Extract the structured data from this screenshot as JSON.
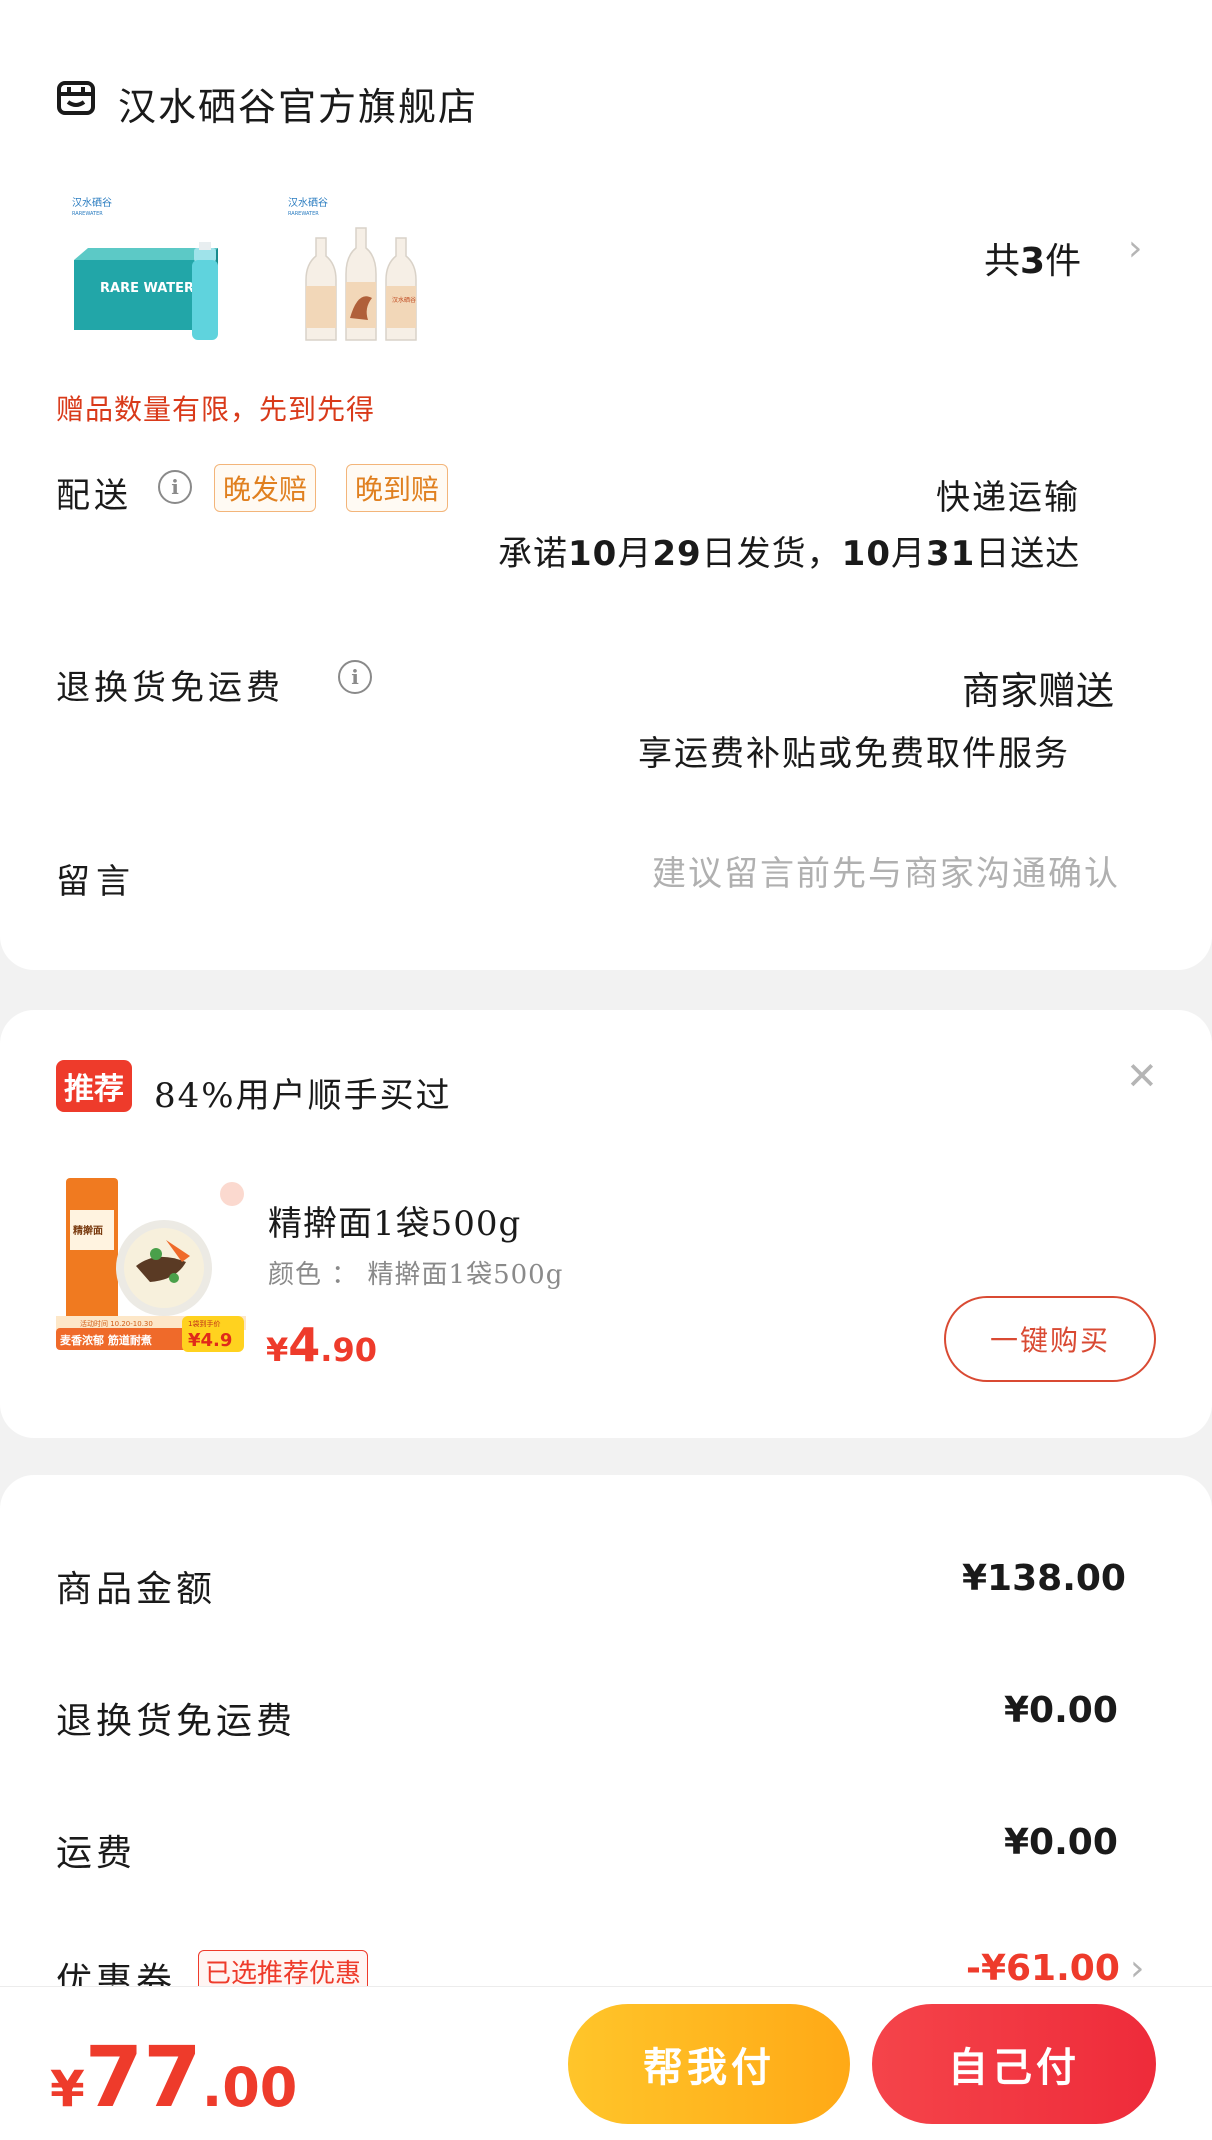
{
  "store": {
    "name": "汉水硒谷官方旗舰店",
    "items": [
      {
        "brand": "汉水硒谷",
        "brand_en": "RAREWATER",
        "box_text": "RARE WATER",
        "icon": "water-box-image"
      },
      {
        "brand": "汉水硒谷",
        "brand_en": "RAREWATER",
        "label_text": "汉水硒谷",
        "icon": "water-bottles-image"
      }
    ],
    "count_prefix": "共",
    "count": "3",
    "count_suffix": "件",
    "gift_note": "赠品数量有限，先到先得",
    "delivery": {
      "label": "配送",
      "tags": [
        "晚发赔",
        "晚到赔"
      ],
      "method": "快递运输",
      "promise_parts": [
        "承诺",
        "10",
        "月",
        "29",
        "日发货，",
        "10",
        "月",
        "31",
        "日送达"
      ]
    },
    "return_shipping": {
      "label": "退换货免运费",
      "value": "商家赠送",
      "note": "享运费补贴或免费取件服务"
    },
    "message": {
      "label": "留言",
      "placeholder": "建议留言前先与商家沟通确认"
    }
  },
  "recommend": {
    "badge": "推荐",
    "text": "84%用户顺手买过",
    "product": {
      "name": "精擀面1袋500g",
      "variant": "颜色 ： 精擀面1袋500g",
      "price_symbol": "¥",
      "price_int": "4",
      "price_dec": ".90",
      "thumb_banner": "麦香浓郁 筋道耐煮",
      "thumb_price": "¥4.9",
      "thumb_price_label": "1袋到手价",
      "thumb_activity": "活动时间 10.20-10.30",
      "thumb_pack_text": "精擀面"
    },
    "buy_label": "一键购买"
  },
  "summary": {
    "rows": [
      {
        "label": "商品金额",
        "value": "¥138.00"
      },
      {
        "label": "退换货免运费",
        "value": "¥0.00"
      },
      {
        "label": "运费",
        "value": "¥0.00"
      },
      {
        "label": "优惠券",
        "tag": "已选推荐优惠",
        "value": "-¥61.00"
      }
    ]
  },
  "bottom": {
    "total_symbol": "¥",
    "total_int": "77",
    "total_dec": ".00",
    "help_pay": "帮我付",
    "self_pay": "自己付"
  },
  "colors": {
    "accent": "#ee3b2b",
    "help_button": "#ffb81f",
    "tag_orange": "#e08020"
  }
}
